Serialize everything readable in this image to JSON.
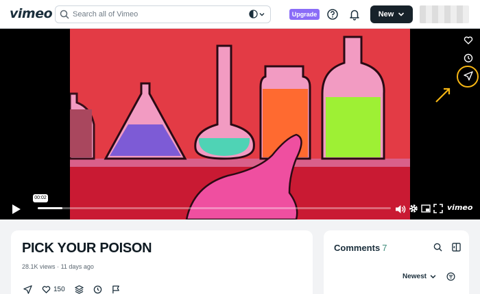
{
  "header": {
    "logo": "vimeo",
    "search_placeholder": "Search all of Vimeo",
    "upgrade_label": "Upgrade",
    "new_label": "New"
  },
  "player": {
    "current_time": "00:02",
    "progress": 0.07,
    "brand": "vimeo"
  },
  "video": {
    "title": "PICK YOUR POISON",
    "views": "28.1K views",
    "posted": "11 days ago",
    "separator": "·",
    "likes": "150"
  },
  "comments": {
    "label": "Comments",
    "count": "7",
    "sort_label": "Newest"
  },
  "colors": {
    "accent_purple": "#8a6cf7",
    "highlight": "#f6b614",
    "dark_button": "#17222a"
  },
  "icons": [
    "search-icon",
    "globe-icon",
    "help-icon",
    "bell-icon",
    "chevron-down-icon",
    "heart-icon",
    "clock-icon",
    "share-icon",
    "play-icon",
    "volume-icon",
    "settings-icon",
    "pip-icon",
    "fullscreen-icon",
    "collections-icon",
    "flag-icon",
    "sort-icon",
    "panel-icon"
  ]
}
